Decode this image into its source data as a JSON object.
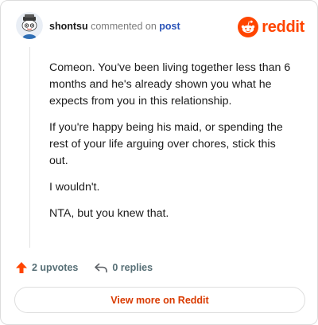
{
  "header": {
    "username": "shontsu",
    "action_text": "commented on",
    "post_link_label": "post",
    "brand_wordmark": "reddit"
  },
  "comment": {
    "paragraphs": [
      "Comeon. You've been living together less than 6 months and he's already shown you what he expects from you in this relationship.",
      "If you're happy being his maid, or spending the rest of your life arguing over chores, stick this out.",
      "I wouldn't.",
      "NTA, but you knew that."
    ]
  },
  "stats": {
    "upvotes_label": "2 upvotes",
    "replies_label": "0 replies"
  },
  "footer": {
    "view_more_label": "View more on Reddit"
  },
  "colors": {
    "brand": "#ff4500",
    "link": "#2a53b8",
    "view_more_text": "#d93a00",
    "upvote_arrow": "#ff4500"
  },
  "icons": {
    "avatar": "snoo-avatar-icon",
    "brand": "reddit-logo-icon",
    "upvote": "upvote-arrow-icon",
    "reply": "reply-arrow-icon"
  }
}
